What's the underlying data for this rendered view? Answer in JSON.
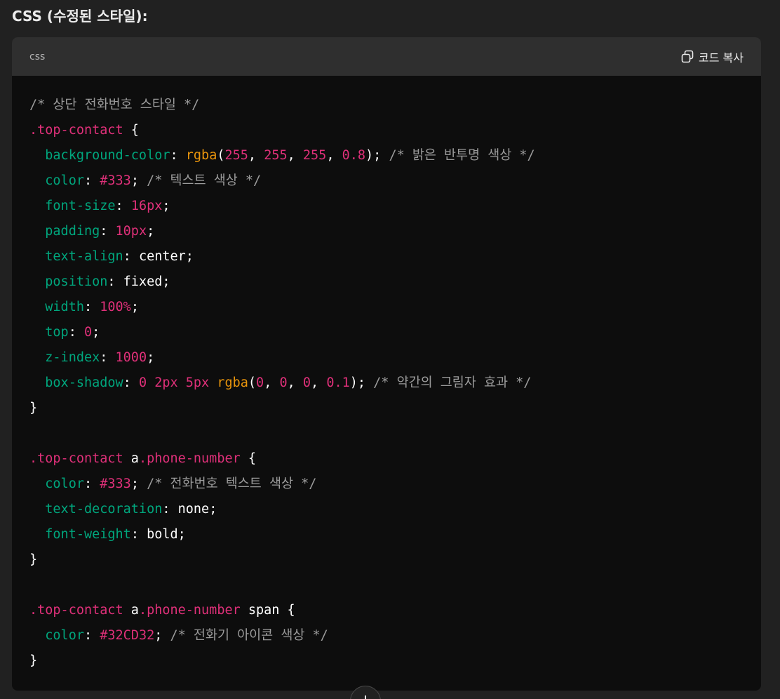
{
  "heading": "CSS (수정된 스타일):",
  "code_block": {
    "language": "css",
    "copy_label": "코드 복사",
    "copy_icon": "copy-icon",
    "scroll_icon": "arrow-down-icon",
    "lines": [
      [
        {
          "t": "/* 상단 전화번호 스타일 */",
          "c": "comment"
        }
      ],
      [
        {
          "t": ".top-contact",
          "c": "selector"
        },
        {
          "t": " {",
          "c": "punct"
        }
      ],
      [
        {
          "t": "  ",
          "c": "punct"
        },
        {
          "t": "background-color",
          "c": "prop"
        },
        {
          "t": ": ",
          "c": "punct"
        },
        {
          "t": "rgba",
          "c": "func2"
        },
        {
          "t": "(",
          "c": "punct"
        },
        {
          "t": "255",
          "c": "num"
        },
        {
          "t": ", ",
          "c": "punct"
        },
        {
          "t": "255",
          "c": "num"
        },
        {
          "t": ", ",
          "c": "punct"
        },
        {
          "t": "255",
          "c": "num"
        },
        {
          "t": ", ",
          "c": "punct"
        },
        {
          "t": "0.8",
          "c": "num"
        },
        {
          "t": "); ",
          "c": "punct"
        },
        {
          "t": "/* 밝은 반투명 색상 */",
          "c": "comment"
        }
      ],
      [
        {
          "t": "  ",
          "c": "punct"
        },
        {
          "t": "color",
          "c": "prop"
        },
        {
          "t": ": ",
          "c": "punct"
        },
        {
          "t": "#333",
          "c": "num"
        },
        {
          "t": "; ",
          "c": "punct"
        },
        {
          "t": "/* 텍스트 색상 */",
          "c": "comment"
        }
      ],
      [
        {
          "t": "  ",
          "c": "punct"
        },
        {
          "t": "font-size",
          "c": "prop"
        },
        {
          "t": ": ",
          "c": "punct"
        },
        {
          "t": "16px",
          "c": "num"
        },
        {
          "t": ";",
          "c": "punct"
        }
      ],
      [
        {
          "t": "  ",
          "c": "punct"
        },
        {
          "t": "padding",
          "c": "prop"
        },
        {
          "t": ": ",
          "c": "punct"
        },
        {
          "t": "10px",
          "c": "num"
        },
        {
          "t": ";",
          "c": "punct"
        }
      ],
      [
        {
          "t": "  ",
          "c": "punct"
        },
        {
          "t": "text-align",
          "c": "prop"
        },
        {
          "t": ": ",
          "c": "punct"
        },
        {
          "t": "center",
          "c": "val"
        },
        {
          "t": ";",
          "c": "punct"
        }
      ],
      [
        {
          "t": "  ",
          "c": "punct"
        },
        {
          "t": "position",
          "c": "prop"
        },
        {
          "t": ": ",
          "c": "punct"
        },
        {
          "t": "fixed",
          "c": "val"
        },
        {
          "t": ";",
          "c": "punct"
        }
      ],
      [
        {
          "t": "  ",
          "c": "punct"
        },
        {
          "t": "width",
          "c": "prop"
        },
        {
          "t": ": ",
          "c": "punct"
        },
        {
          "t": "100%",
          "c": "num"
        },
        {
          "t": ";",
          "c": "punct"
        }
      ],
      [
        {
          "t": "  ",
          "c": "punct"
        },
        {
          "t": "top",
          "c": "prop"
        },
        {
          "t": ": ",
          "c": "punct"
        },
        {
          "t": "0",
          "c": "num"
        },
        {
          "t": ";",
          "c": "punct"
        }
      ],
      [
        {
          "t": "  ",
          "c": "punct"
        },
        {
          "t": "z-index",
          "c": "prop"
        },
        {
          "t": ": ",
          "c": "punct"
        },
        {
          "t": "1000",
          "c": "num"
        },
        {
          "t": ";",
          "c": "punct"
        }
      ],
      [
        {
          "t": "  ",
          "c": "punct"
        },
        {
          "t": "box-shadow",
          "c": "prop"
        },
        {
          "t": ": ",
          "c": "punct"
        },
        {
          "t": "0 2px 5px ",
          "c": "num"
        },
        {
          "t": "rgba",
          "c": "func2"
        },
        {
          "t": "(",
          "c": "punct"
        },
        {
          "t": "0",
          "c": "num"
        },
        {
          "t": ", ",
          "c": "punct"
        },
        {
          "t": "0",
          "c": "num"
        },
        {
          "t": ", ",
          "c": "punct"
        },
        {
          "t": "0",
          "c": "num"
        },
        {
          "t": ", ",
          "c": "punct"
        },
        {
          "t": "0.1",
          "c": "num"
        },
        {
          "t": "); ",
          "c": "punct"
        },
        {
          "t": "/* 약간의 그림자 효과 */",
          "c": "comment"
        }
      ],
      [
        {
          "t": "}",
          "c": "punct"
        }
      ],
      [
        {
          "t": "",
          "c": "punct"
        }
      ],
      [
        {
          "t": ".top-contact",
          "c": "selector"
        },
        {
          "t": " a",
          "c": "tag"
        },
        {
          "t": ".phone-number",
          "c": "selector"
        },
        {
          "t": " {",
          "c": "punct"
        }
      ],
      [
        {
          "t": "  ",
          "c": "punct"
        },
        {
          "t": "color",
          "c": "prop"
        },
        {
          "t": ": ",
          "c": "punct"
        },
        {
          "t": "#333",
          "c": "num"
        },
        {
          "t": "; ",
          "c": "punct"
        },
        {
          "t": "/* 전화번호 텍스트 색상 */",
          "c": "comment"
        }
      ],
      [
        {
          "t": "  ",
          "c": "punct"
        },
        {
          "t": "text-decoration",
          "c": "prop"
        },
        {
          "t": ": ",
          "c": "punct"
        },
        {
          "t": "none",
          "c": "val"
        },
        {
          "t": ";",
          "c": "punct"
        }
      ],
      [
        {
          "t": "  ",
          "c": "punct"
        },
        {
          "t": "font-weight",
          "c": "prop"
        },
        {
          "t": ": ",
          "c": "punct"
        },
        {
          "t": "bold",
          "c": "val"
        },
        {
          "t": ";",
          "c": "punct"
        }
      ],
      [
        {
          "t": "}",
          "c": "punct"
        }
      ],
      [
        {
          "t": "",
          "c": "punct"
        }
      ],
      [
        {
          "t": ".top-contact",
          "c": "selector"
        },
        {
          "t": " a",
          "c": "tag"
        },
        {
          "t": ".phone-number",
          "c": "selector"
        },
        {
          "t": " span {",
          "c": "punct"
        }
      ],
      [
        {
          "t": "  ",
          "c": "punct"
        },
        {
          "t": "color",
          "c": "prop"
        },
        {
          "t": ": ",
          "c": "punct"
        },
        {
          "t": "#32CD32",
          "c": "num"
        },
        {
          "t": "; ",
          "c": "punct"
        },
        {
          "t": "/* 전화기 아이콘 색상 */",
          "c": "comment"
        }
      ],
      [
        {
          "t": "}",
          "c": "punct"
        }
      ]
    ]
  },
  "colors": {
    "page_bg": "#212121",
    "code_bg": "#0d0d0d",
    "header_bg": "#2f2f2f",
    "comment": "#9b9b9b",
    "selector": "#df3079",
    "property": "#00a67d",
    "number": "#df3079",
    "function": "#e9950c"
  }
}
